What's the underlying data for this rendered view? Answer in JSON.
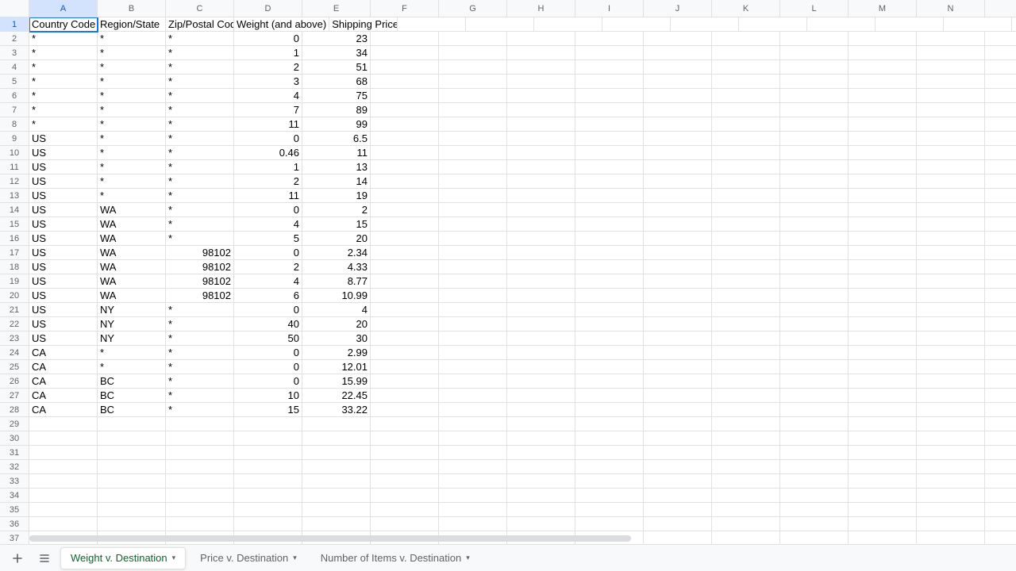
{
  "columns": [
    "A",
    "B",
    "C",
    "D",
    "E",
    "F",
    "G",
    "H",
    "I",
    "J",
    "K",
    "L",
    "M",
    "N"
  ],
  "visibleRows": 37,
  "activeCell": {
    "row": 0,
    "col": 0
  },
  "headers": [
    "Country Code",
    "Region/State",
    "Zip/Postal Code",
    "Weight (and above)",
    "Shipping Price"
  ],
  "rows": [
    {
      "A": "*",
      "B": "*",
      "C": "*",
      "D": 0,
      "E": 23
    },
    {
      "A": "*",
      "B": "*",
      "C": "*",
      "D": 1,
      "E": 34
    },
    {
      "A": "*",
      "B": "*",
      "C": "*",
      "D": 2,
      "E": 51
    },
    {
      "A": "*",
      "B": "*",
      "C": "*",
      "D": 3,
      "E": 68
    },
    {
      "A": "*",
      "B": "*",
      "C": "*",
      "D": 4,
      "E": 75
    },
    {
      "A": "*",
      "B": "*",
      "C": "*",
      "D": 7,
      "E": 89
    },
    {
      "A": "*",
      "B": "*",
      "C": "*",
      "D": 11,
      "E": 99
    },
    {
      "A": "US",
      "B": "*",
      "C": "*",
      "D": 0,
      "E": 6.5
    },
    {
      "A": "US",
      "B": "*",
      "C": "*",
      "D": 0.46,
      "E": 11
    },
    {
      "A": "US",
      "B": "*",
      "C": "*",
      "D": 1,
      "E": 13
    },
    {
      "A": "US",
      "B": "*",
      "C": "*",
      "D": 2,
      "E": 14
    },
    {
      "A": "US",
      "B": "*",
      "C": "*",
      "D": 11,
      "E": 19
    },
    {
      "A": "US",
      "B": "WA",
      "C": "*",
      "D": 0,
      "E": 2
    },
    {
      "A": "US",
      "B": "WA",
      "C": "*",
      "D": 4,
      "E": 15
    },
    {
      "A": "US",
      "B": "WA",
      "C": "*",
      "D": 5,
      "E": 20
    },
    {
      "A": "US",
      "B": "WA",
      "C": 98102,
      "D": 0,
      "E": 2.34
    },
    {
      "A": "US",
      "B": "WA",
      "C": 98102,
      "D": 2,
      "E": 4.33
    },
    {
      "A": "US",
      "B": "WA",
      "C": 98102,
      "D": 4,
      "E": 8.77
    },
    {
      "A": "US",
      "B": "WA",
      "C": 98102,
      "D": 6,
      "E": 10.99
    },
    {
      "A": "US",
      "B": "NY",
      "C": "*",
      "D": 0,
      "E": 4
    },
    {
      "A": "US",
      "B": "NY",
      "C": "*",
      "D": 40,
      "E": 20
    },
    {
      "A": "US",
      "B": "NY",
      "C": "*",
      "D": 50,
      "E": 30
    },
    {
      "A": "CA",
      "B": "*",
      "C": "*",
      "D": 0,
      "E": 2.99
    },
    {
      "A": "CA",
      "B": "*",
      "C": "*",
      "D": 0,
      "E": 12.01
    },
    {
      "A": "CA",
      "B": "BC",
      "C": "*",
      "D": 0,
      "E": 15.99
    },
    {
      "A": "CA",
      "B": "BC",
      "C": "*",
      "D": 10,
      "E": 22.45
    },
    {
      "A": "CA",
      "B": "BC",
      "C": "*",
      "D": 15,
      "E": 33.22
    }
  ],
  "tabs": [
    {
      "label": "Weight v. Destination",
      "active": true
    },
    {
      "label": "Price v. Destination",
      "active": false
    },
    {
      "label": "Number of Items v. Destination",
      "active": false
    }
  ],
  "icons": {
    "add": "+",
    "menu": "≡"
  }
}
